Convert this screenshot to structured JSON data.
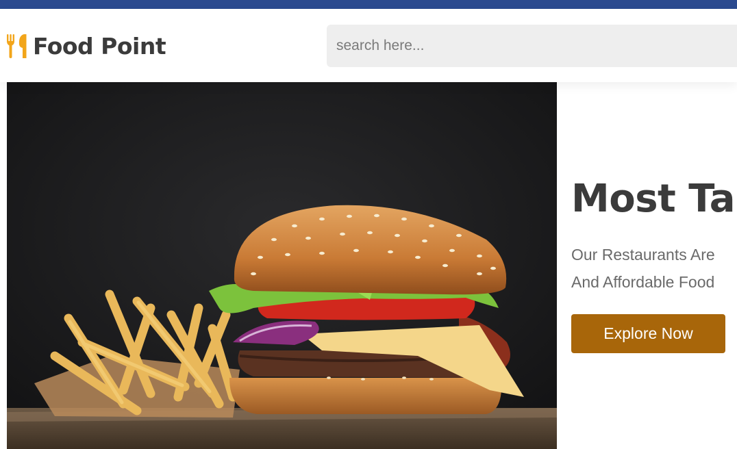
{
  "header": {
    "brand": "Food Point",
    "logo_icon": "fork-and-spoon-icon",
    "search": {
      "placeholder": "search here..."
    }
  },
  "hero": {
    "image": "burger-and-fries-photo",
    "title": "Most Tas",
    "description_lines": [
      "Our Restaurants Are",
      "And Affordable Food"
    ],
    "cta_label": "Explore Now"
  },
  "colors": {
    "top_bar": "#2b4a8f",
    "accent": "#f2a51a",
    "button": "#a8660a",
    "heading_text": "#3b3b3b"
  }
}
